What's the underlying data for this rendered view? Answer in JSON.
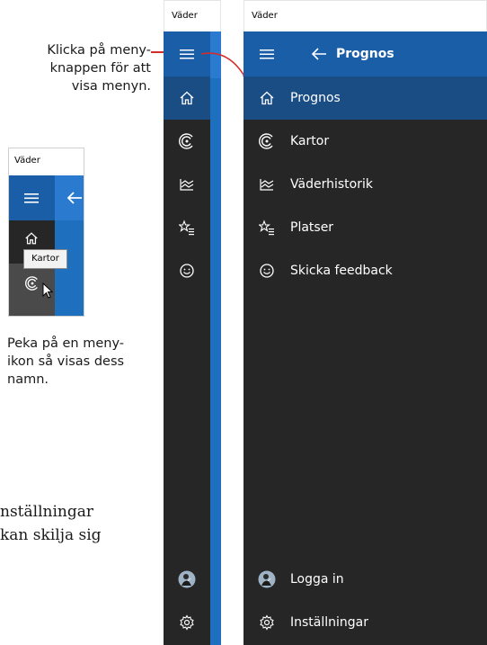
{
  "annotations": {
    "menu_button_callout": [
      "Klicka på meny-",
      "knappen för att",
      "visa menyn."
    ],
    "hover_callout": [
      "Peka på en meny-",
      "ikon så visas dess",
      "namn."
    ],
    "body_text": [
      "nställningar",
      "kan skilja sig"
    ]
  },
  "inset": {
    "window_title": "Väder",
    "tooltip": "Kartor"
  },
  "collapsed_app": {
    "window_title": "Väder",
    "icons": [
      "hamburger-icon",
      "home-icon",
      "maps-icon",
      "history-icon",
      "places-icon",
      "feedback-icon",
      "avatar",
      "settings-icon"
    ]
  },
  "expanded_app": {
    "window_title": "Väder",
    "header_title": "Prognos",
    "menu": [
      {
        "label": "Prognos",
        "icon": "home-icon",
        "active": true
      },
      {
        "label": "Kartor",
        "icon": "maps-icon"
      },
      {
        "label": "Väderhistorik",
        "icon": "history-icon"
      },
      {
        "label": "Platser",
        "icon": "places-icon"
      },
      {
        "label": "Skicka feedback",
        "icon": "feedback-icon"
      }
    ],
    "footer": [
      {
        "label": "Logga in",
        "icon": "avatar"
      },
      {
        "label": "Inställningar",
        "icon": "settings-icon"
      }
    ]
  },
  "colors": {
    "pane_dark": "#262626",
    "header_blue": "#1a5ea8",
    "active_blue": "#1b4d85",
    "accent_blue": "#1f6fbf",
    "arrow_red": "#d62b2b"
  }
}
